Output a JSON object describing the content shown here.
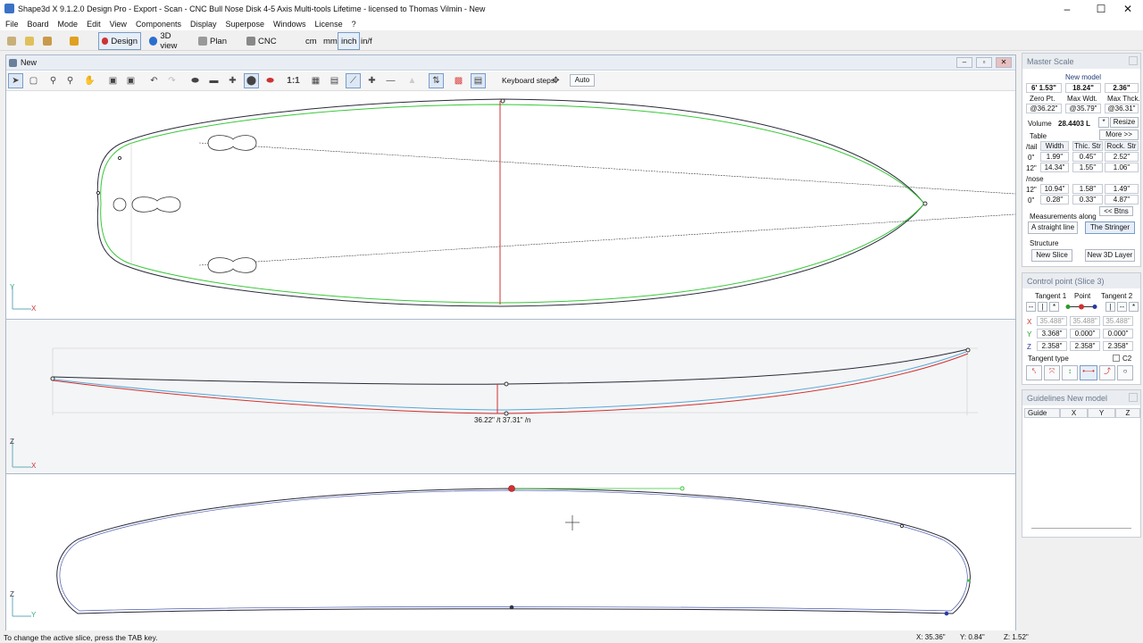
{
  "window": {
    "title": "Shape3d X 9.1.2.0 Design Pro - Export - Scan - CNC Bull Nose Disk 4-5 Axis Multi-tools Lifetime - licensed to Thomas Vilmin - New"
  },
  "menu": [
    "File",
    "Board",
    "Mode",
    "Edit",
    "View",
    "Components",
    "Display",
    "Superpose",
    "Windows",
    "License",
    "?"
  ],
  "toolbar": {
    "design": "Design",
    "view3d": "3D view",
    "plan": "Plan",
    "cnc": "CNC",
    "cm": "cm",
    "mm": "mm",
    "inch": "inch",
    "inf": "in/f"
  },
  "doc": {
    "title": "New",
    "keyboard_steps": "Keyboard steps",
    "auto": "Auto",
    "scale": "1:1",
    "rocker_label": "36.22\" /t 37.31\" /n"
  },
  "axes": {
    "top_x": "X",
    "top_y": "Y",
    "side_x": "X",
    "side_z": "Z",
    "front_y": "Y",
    "front_z": "Z"
  },
  "status": {
    "hint": "To change the active slice, press the TAB key.",
    "x": "X: 35.36\"",
    "y": "Y: 0.84\"",
    "z": "Z: 1.52\""
  },
  "master": {
    "title": "Master Scale",
    "model": "New model",
    "length": "6' 1.53\"",
    "width": "18.24\"",
    "thick": "2.36\"",
    "zero_lbl": "Zero Pt.",
    "maxw_lbl": "Max Wdt.",
    "maxt_lbl": "Max Thck.",
    "zero": "@36.22\"",
    "maxw": "@35.79\"",
    "maxt": "@36.31\"",
    "volume_lbl": "Volume",
    "volume": "28.4403 L",
    "star": "*",
    "resize": "Resize",
    "more": "More >>",
    "table_lbl": "Table",
    "tail_lbl": "/tail",
    "nose_lbl": "/nose",
    "cols": [
      "Width",
      "Thic. Str",
      "Rock. Str"
    ],
    "rows": [
      {
        "pos": "0\"",
        "w": "1.99\"",
        "t": "0.45\"",
        "r": "2.52\""
      },
      {
        "pos": "12\"",
        "w": "14.34\"",
        "t": "1.55\"",
        "r": "1.06\""
      },
      {
        "pos": "12\"",
        "w": "10.94\"",
        "t": "1.58\"",
        "r": "1.49\""
      },
      {
        "pos": "0\"",
        "w": "0.28\"",
        "t": "0.33\"",
        "r": "4.87\""
      }
    ],
    "btns": "<< Btns",
    "meas_lbl": "Measurements along",
    "straight": "A straight line",
    "stringer": "The Stringer",
    "struct_lbl": "Structure",
    "new_slice": "New Slice",
    "new_layer": "New 3D Layer"
  },
  "control": {
    "title": "Control point (Slice 3)",
    "t1": "Tangent 1",
    "pt": "Point",
    "t2": "Tangent 2",
    "x_lbl": "X",
    "y_lbl": "Y",
    "z_lbl": "Z",
    "x": [
      "35.488\"",
      "35.488\"",
      "35.488\""
    ],
    "y": [
      "3.368\"",
      "0.000\"",
      "0.000\""
    ],
    "z": [
      "2.358\"",
      "2.358\"",
      "2.358\""
    ],
    "ttype": "Tangent type",
    "c2": "C2",
    "sym1": "--",
    "sym2": "|",
    "sym3": "*"
  },
  "guides": {
    "title": "Guidelines New model",
    "cols": [
      "Guide",
      "X",
      "Y",
      "Z"
    ]
  },
  "colors": {
    "outline": "#2a2a3a",
    "green": "#38c838",
    "red": "#d23030",
    "blue": "#5aa8d8"
  }
}
